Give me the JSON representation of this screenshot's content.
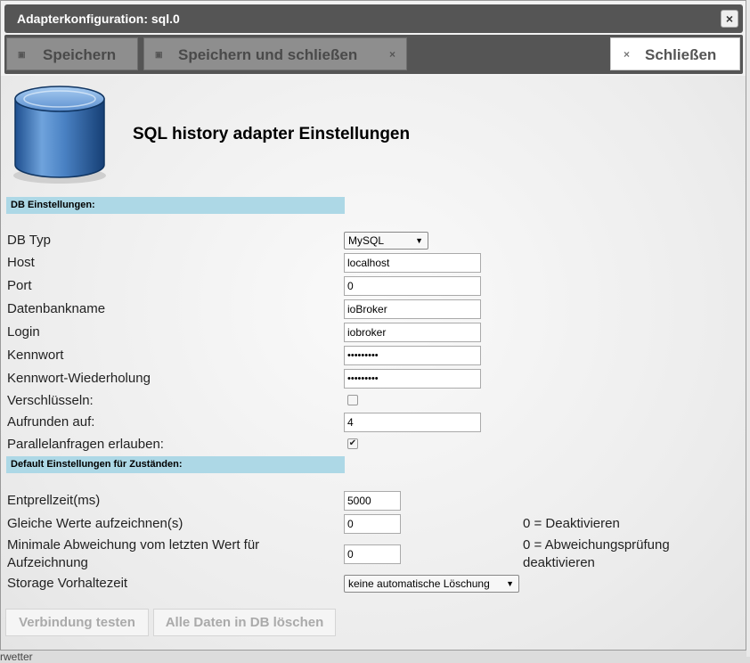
{
  "window": {
    "title": "Adapterkonfiguration: sql.0",
    "close_symbol": "×"
  },
  "toolbar": {
    "save_label": "Speichern",
    "save_close_label": "Speichern und schließen",
    "close_label": "Schließen",
    "x_symbol": "×",
    "save_icon_symbol": "▣"
  },
  "header": {
    "title": "SQL history adapter Einstellungen",
    "icon": "database-icon"
  },
  "sections": {
    "db": "DB Einstellungen:",
    "defaults": "Default Einstellungen für Zuständen:"
  },
  "db_settings": {
    "db_type_label": "DB Typ",
    "db_type_value": "MySQL",
    "host_label": "Host",
    "host_value": "localhost",
    "port_label": "Port",
    "port_value": "0",
    "dbname_label": "Datenbankname",
    "dbname_value": "ioBroker",
    "login_label": "Login",
    "login_value": "iobroker",
    "password_label": "Kennwort",
    "password_value": "•••••••••",
    "password_repeat_label": "Kennwort-Wiederholung",
    "password_repeat_value": "•••••••••",
    "encrypt_label": "Verschlüsseln:",
    "encrypt_checked": false,
    "round_label": "Aufrunden auf:",
    "round_value": "4",
    "parallel_label": "Parallelanfragen erlauben:",
    "parallel_checked": true
  },
  "defaults": {
    "debounce_label": "Entprellzeit(ms)",
    "debounce_value": "5000",
    "same_values_label": "Gleiche Werte aufzeichnen(s)",
    "same_values_value": "0",
    "same_values_hint": "0 = Deaktivieren",
    "min_change_label_1": "Minimale Abweichung vom letzten Wert für",
    "min_change_label_2": "Aufzeichnung",
    "min_change_value": "0",
    "min_change_hint_1": "0 = Abweichungsprüfung",
    "min_change_hint_2": "deaktivieren",
    "retention_label": "Storage Vorhaltezeit",
    "retention_value": "keine automatische Löschung"
  },
  "buttons": {
    "test_connection": "Verbindung testen",
    "delete_all": "Alle Daten in DB löschen"
  },
  "background": {
    "partial_text": "rwetter"
  },
  "colors": {
    "section_bg": "#add8e6",
    "titlebar": "#555555",
    "toolbar": "#555555"
  }
}
